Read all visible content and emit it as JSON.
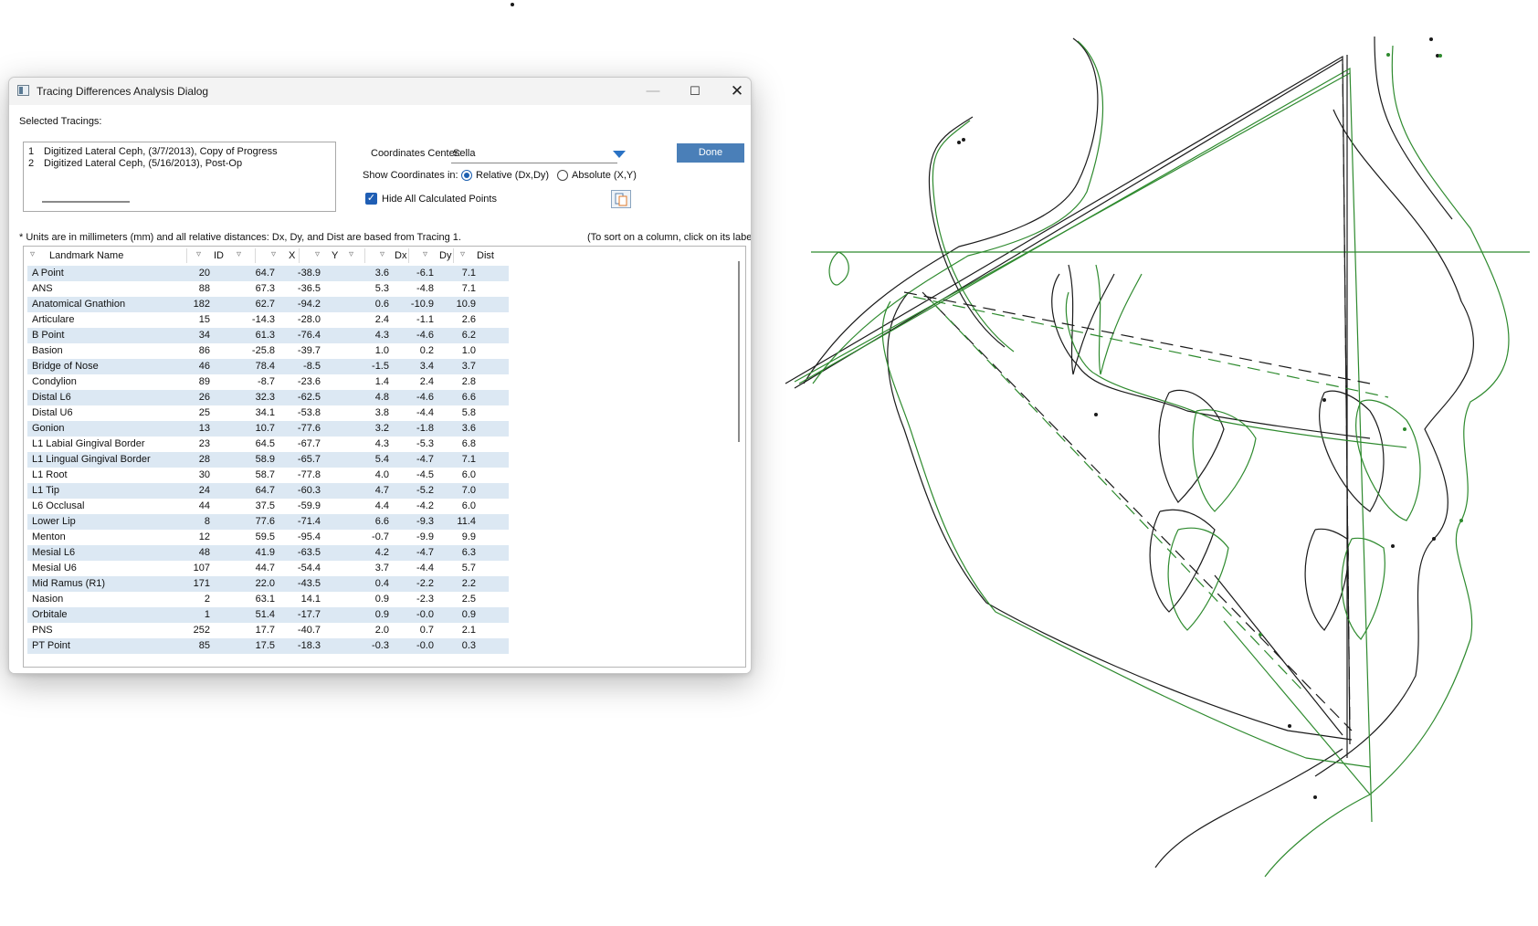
{
  "dialog": {
    "title": "Tracing Differences Analysis Dialog",
    "window_buttons": {
      "minimize": "—",
      "maximize": "☐",
      "close": "✕"
    },
    "selected_tracings_label": "Selected Tracings:",
    "tracings": [
      {
        "num": "1",
        "name": "Digitized Lateral Ceph, (3/7/2013), Copy of Progress"
      },
      {
        "num": "2",
        "name": "Digitized Lateral Ceph, (5/16/2013), Post-Op"
      }
    ],
    "coordinates_center": {
      "label": "Coordinates Center:",
      "value": "Sella"
    },
    "done_label": "Done",
    "show_coords": {
      "label": "Show Coordinates in:",
      "relative": "Relative (Dx,Dy)",
      "absolute": "Absolute (X,Y)",
      "selected": "relative"
    },
    "hide_calculated": {
      "label": "Hide All Calculated Points",
      "checked": true
    },
    "units_note": "* Units are in millimeters (mm) and all relative distances: Dx, Dy, and Dist are based from Tracing 1.",
    "sort_note": "(To sort on a column, click on its label)",
    "table": {
      "headers": {
        "name": "Landmark Name",
        "id": "ID",
        "x": "X",
        "y": "Y",
        "dx": "Dx",
        "dy": "Dy",
        "dist": "Dist"
      },
      "rows": [
        {
          "name": "A Point",
          "id": "20",
          "x": "64.7",
          "y": "-38.9",
          "dx": "3.6",
          "dy": "-6.1",
          "dist": "7.1"
        },
        {
          "name": "ANS",
          "id": "88",
          "x": "67.3",
          "y": "-36.5",
          "dx": "5.3",
          "dy": "-4.8",
          "dist": "7.1"
        },
        {
          "name": "Anatomical Gnathion",
          "id": "182",
          "x": "62.7",
          "y": "-94.2",
          "dx": "0.6",
          "dy": "-10.9",
          "dist": "10.9"
        },
        {
          "name": "Articulare",
          "id": "15",
          "x": "-14.3",
          "y": "-28.0",
          "dx": "2.4",
          "dy": "-1.1",
          "dist": "2.6"
        },
        {
          "name": "B Point",
          "id": "34",
          "x": "61.3",
          "y": "-76.4",
          "dx": "4.3",
          "dy": "-4.6",
          "dist": "6.2"
        },
        {
          "name": "Basion",
          "id": "86",
          "x": "-25.8",
          "y": "-39.7",
          "dx": "1.0",
          "dy": "0.2",
          "dist": "1.0"
        },
        {
          "name": "Bridge of Nose",
          "id": "46",
          "x": "78.4",
          "y": "-8.5",
          "dx": "-1.5",
          "dy": "3.4",
          "dist": "3.7"
        },
        {
          "name": "Condylion",
          "id": "89",
          "x": "-8.7",
          "y": "-23.6",
          "dx": "1.4",
          "dy": "2.4",
          "dist": "2.8"
        },
        {
          "name": "Distal L6",
          "id": "26",
          "x": "32.3",
          "y": "-62.5",
          "dx": "4.8",
          "dy": "-4.6",
          "dist": "6.6"
        },
        {
          "name": "Distal U6",
          "id": "25",
          "x": "34.1",
          "y": "-53.8",
          "dx": "3.8",
          "dy": "-4.4",
          "dist": "5.8"
        },
        {
          "name": "Gonion",
          "id": "13",
          "x": "10.7",
          "y": "-77.6",
          "dx": "3.2",
          "dy": "-1.8",
          "dist": "3.6"
        },
        {
          "name": "L1 Labial Gingival Border",
          "id": "23",
          "x": "64.5",
          "y": "-67.7",
          "dx": "4.3",
          "dy": "-5.3",
          "dist": "6.8"
        },
        {
          "name": "L1 Lingual Gingival Border",
          "id": "28",
          "x": "58.9",
          "y": "-65.7",
          "dx": "5.4",
          "dy": "-4.7",
          "dist": "7.1"
        },
        {
          "name": "L1 Root",
          "id": "30",
          "x": "58.7",
          "y": "-77.8",
          "dx": "4.0",
          "dy": "-4.5",
          "dist": "6.0"
        },
        {
          "name": "L1 Tip",
          "id": "24",
          "x": "64.7",
          "y": "-60.3",
          "dx": "4.7",
          "dy": "-5.2",
          "dist": "7.0"
        },
        {
          "name": "L6 Occlusal",
          "id": "44",
          "x": "37.5",
          "y": "-59.9",
          "dx": "4.4",
          "dy": "-4.2",
          "dist": "6.0"
        },
        {
          "name": "Lower Lip",
          "id": "8",
          "x": "77.6",
          "y": "-71.4",
          "dx": "6.6",
          "dy": "-9.3",
          "dist": "11.4"
        },
        {
          "name": "Menton",
          "id": "12",
          "x": "59.5",
          "y": "-95.4",
          "dx": "-0.7",
          "dy": "-9.9",
          "dist": "9.9"
        },
        {
          "name": "Mesial L6",
          "id": "48",
          "x": "41.9",
          "y": "-63.5",
          "dx": "4.2",
          "dy": "-4.7",
          "dist": "6.3"
        },
        {
          "name": "Mesial U6",
          "id": "107",
          "x": "44.7",
          "y": "-54.4",
          "dx": "3.7",
          "dy": "-4.4",
          "dist": "5.7"
        },
        {
          "name": "Mid Ramus (R1)",
          "id": "171",
          "x": "22.0",
          "y": "-43.5",
          "dx": "0.4",
          "dy": "-2.2",
          "dist": "2.2"
        },
        {
          "name": "Nasion",
          "id": "2",
          "x": "63.1",
          "y": "14.1",
          "dx": "0.9",
          "dy": "-2.3",
          "dist": "2.5"
        },
        {
          "name": "Orbitale",
          "id": "1",
          "x": "51.4",
          "y": "-17.7",
          "dx": "0.9",
          "dy": "-0.0",
          "dist": "0.9"
        },
        {
          "name": "PNS",
          "id": "252",
          "x": "17.7",
          "y": "-40.7",
          "dx": "2.0",
          "dy": "0.7",
          "dist": "2.1"
        },
        {
          "name": "PT Point",
          "id": "85",
          "x": "17.5",
          "y": "-18.3",
          "dx": "-0.3",
          "dy": "-0.0",
          "dist": "0.3"
        }
      ]
    }
  },
  "tracing_colors": {
    "tracing1": "#1a1a1a",
    "tracing2": "#2e8a2e"
  },
  "colors": {
    "accent": "#4a7fb8",
    "row_alt": "#dce8f3"
  }
}
